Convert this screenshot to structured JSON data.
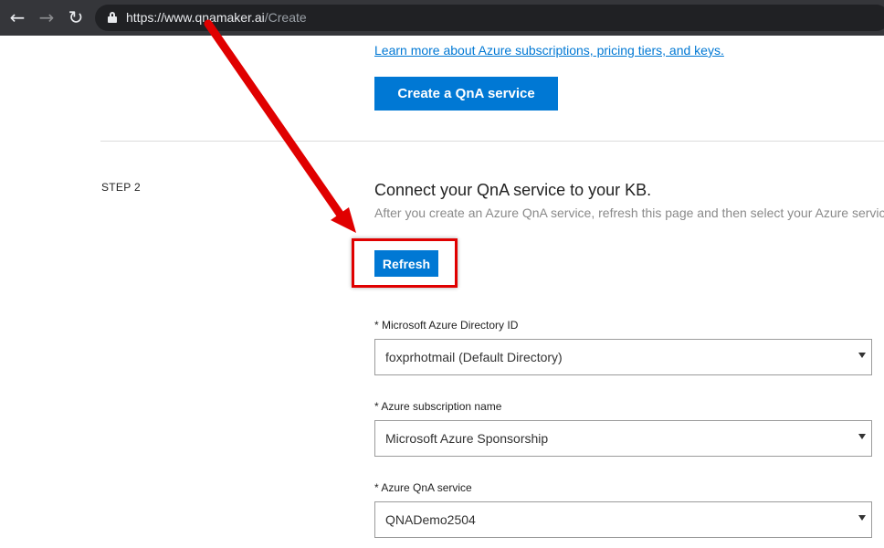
{
  "browser": {
    "url_host": "https://www.qnamaker.ai",
    "url_path": "/Create",
    "back_icon": "arrow-left-icon",
    "forward_icon": "arrow-right-icon",
    "reload_icon": "reload-icon",
    "lock_icon": "lock-icon"
  },
  "step1": {
    "learn_more_link": "Learn more about Azure subscriptions, pricing tiers, and keys.",
    "create_button": "Create a QnA service"
  },
  "step2": {
    "step_label": "STEP 2",
    "title": "Connect your QnA service to your KB.",
    "description": "After you create an Azure QnA service, refresh this page and then select your Azure service using the options below",
    "refresh_button": "Refresh",
    "fields": [
      {
        "label": "* Microsoft Azure Directory ID",
        "value": "foxprhotmail (Default Directory)"
      },
      {
        "label": "* Azure subscription name",
        "value": "Microsoft Azure Sponsorship"
      },
      {
        "label": "* Azure QnA service",
        "value": "QNADemo2504"
      }
    ]
  },
  "colors": {
    "accent": "#0078d4",
    "annotation_red": "#e00000",
    "browser_chrome": "#35363a"
  }
}
